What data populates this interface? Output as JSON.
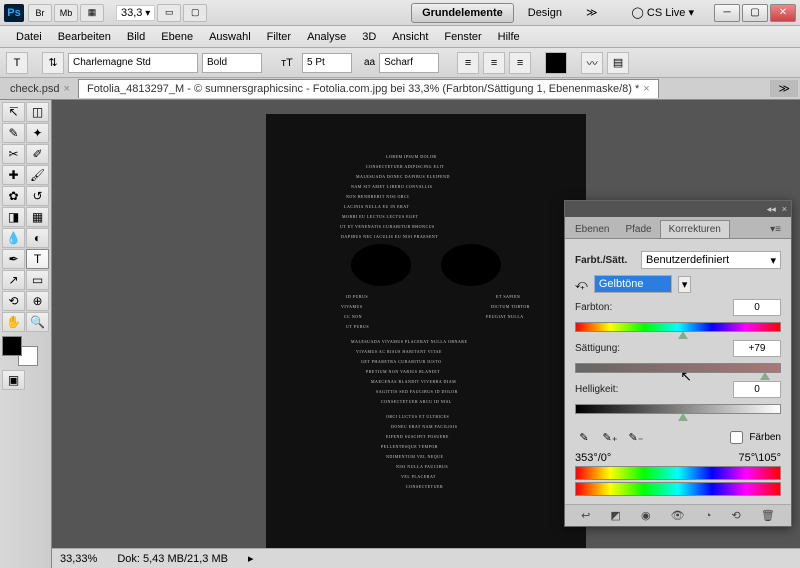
{
  "titlebar": {
    "ps": "Ps",
    "bridge": "Br",
    "mb": "Mb",
    "zoom": "33,3",
    "workspace_active": "Grundelemente",
    "workspace_other": "Design",
    "cslive": "CS Live"
  },
  "menu": [
    "Datei",
    "Bearbeiten",
    "Bild",
    "Ebene",
    "Auswahl",
    "Filter",
    "Analyse",
    "3D",
    "Ansicht",
    "Fenster",
    "Hilfe"
  ],
  "options": {
    "font_family": "Charlemagne Std",
    "font_style": "Bold",
    "size": "5 Pt",
    "aa_label": "aa",
    "aa": "Scharf"
  },
  "tabs": {
    "inactive": "check.psd",
    "active": "Fotolia_4813297_M - © sumnersgraphicsinc - Fotolia.com.jpg bei 33,3% (Farbton/Sättigung 1, Ebenenmaske/8) *"
  },
  "panel": {
    "tabs": [
      "Ebenen",
      "Pfade",
      "Korrekturen"
    ],
    "title": "Farbt./Sätt.",
    "preset": "Benutzerdefiniert",
    "channel": "Gelbtöne",
    "hue_label": "Farbton:",
    "hue_val": "0",
    "sat_label": "Sättigung:",
    "sat_val": "+79",
    "lig_label": "Helligkeit:",
    "lig_val": "0",
    "colorize": "Färben",
    "readout_left": "353°/0°",
    "readout_right": "75°\\105°"
  },
  "status": {
    "zoom": "33,33%",
    "doc": "Dok: 5,43 MB/21,3 MB"
  }
}
